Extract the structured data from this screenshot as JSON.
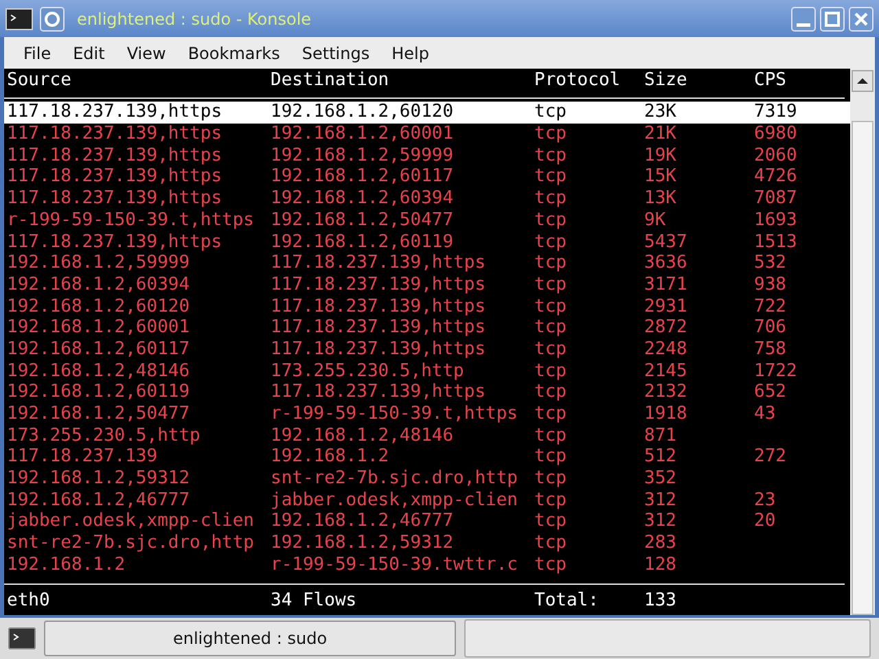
{
  "window": {
    "title": "enlightened : sudo - Konsole"
  },
  "menu": [
    "File",
    "Edit",
    "View",
    "Bookmarks",
    "Settings",
    "Help"
  ],
  "table": {
    "columns": [
      "Source",
      "Destination",
      "Protocol",
      "Size",
      "CPS"
    ],
    "rows": [
      {
        "cells": [
          "117.18.237.139,https",
          "192.168.1.2,60120",
          "tcp",
          "23K",
          "7319"
        ],
        "selected": true
      },
      {
        "cells": [
          "117.18.237.139,https",
          "192.168.1.2,60001",
          "tcp",
          "21K",
          "6980"
        ],
        "selected": false
      },
      {
        "cells": [
          "117.18.237.139,https",
          "192.168.1.2,59999",
          "tcp",
          "19K",
          "2060"
        ],
        "selected": false
      },
      {
        "cells": [
          "117.18.237.139,https",
          "192.168.1.2,60117",
          "tcp",
          "15K",
          "4726"
        ],
        "selected": false
      },
      {
        "cells": [
          "117.18.237.139,https",
          "192.168.1.2,60394",
          "tcp",
          "13K",
          "7087"
        ],
        "selected": false
      },
      {
        "cells": [
          "r-199-59-150-39.t,https",
          "192.168.1.2,50477",
          "tcp",
          "9K",
          "1693"
        ],
        "selected": false
      },
      {
        "cells": [
          "117.18.237.139,https",
          "192.168.1.2,60119",
          "tcp",
          "5437",
          "1513"
        ],
        "selected": false
      },
      {
        "cells": [
          "192.168.1.2,59999",
          "117.18.237.139,https",
          "tcp",
          "3636",
          "532"
        ],
        "selected": false
      },
      {
        "cells": [
          "192.168.1.2,60394",
          "117.18.237.139,https",
          "tcp",
          "3171",
          "938"
        ],
        "selected": false
      },
      {
        "cells": [
          "192.168.1.2,60120",
          "117.18.237.139,https",
          "tcp",
          "2931",
          "722"
        ],
        "selected": false
      },
      {
        "cells": [
          "192.168.1.2,60001",
          "117.18.237.139,https",
          "tcp",
          "2872",
          "706"
        ],
        "selected": false
      },
      {
        "cells": [
          "192.168.1.2,60117",
          "117.18.237.139,https",
          "tcp",
          "2248",
          "758"
        ],
        "selected": false
      },
      {
        "cells": [
          "192.168.1.2,48146",
          "173.255.230.5,http",
          "tcp",
          "2145",
          "1722"
        ],
        "selected": false
      },
      {
        "cells": [
          "192.168.1.2,60119",
          "117.18.237.139,https",
          "tcp",
          "2132",
          "652"
        ],
        "selected": false
      },
      {
        "cells": [
          "192.168.1.2,50477",
          "r-199-59-150-39.t,https",
          "tcp",
          "1918",
          "43"
        ],
        "selected": false
      },
      {
        "cells": [
          "173.255.230.5,http",
          "192.168.1.2,48146",
          "tcp",
          "871"
        ],
        "selected": false
      },
      {
        "cells": [
          "117.18.237.139",
          "192.168.1.2",
          "tcp",
          "512",
          "272"
        ],
        "selected": false
      },
      {
        "cells": [
          "192.168.1.2,59312",
          "snt-re2-7b.sjc.dro,http",
          "tcp",
          "352"
        ],
        "selected": false
      },
      {
        "cells": [
          "192.168.1.2,46777",
          "jabber.odesk,xmpp-clien",
          "tcp",
          "312",
          "23"
        ],
        "selected": false
      },
      {
        "cells": [
          "jabber.odesk,xmpp-clien",
          "192.168.1.2,46777",
          "tcp",
          "312",
          "20"
        ],
        "selected": false
      },
      {
        "cells": [
          "snt-re2-7b.sjc.dro,http",
          "192.168.1.2,59312",
          "tcp",
          "283"
        ],
        "selected": false
      },
      {
        "cells": [
          "192.168.1.2",
          "r-199-59-150-39.twttr.c",
          "tcp",
          "128"
        ],
        "selected": false
      }
    ]
  },
  "footer": {
    "interface": "eth0",
    "flows": "34 Flows",
    "total_label": "Total:",
    "total": "133"
  },
  "taskbar": {
    "task": "enlightened : sudo"
  }
}
